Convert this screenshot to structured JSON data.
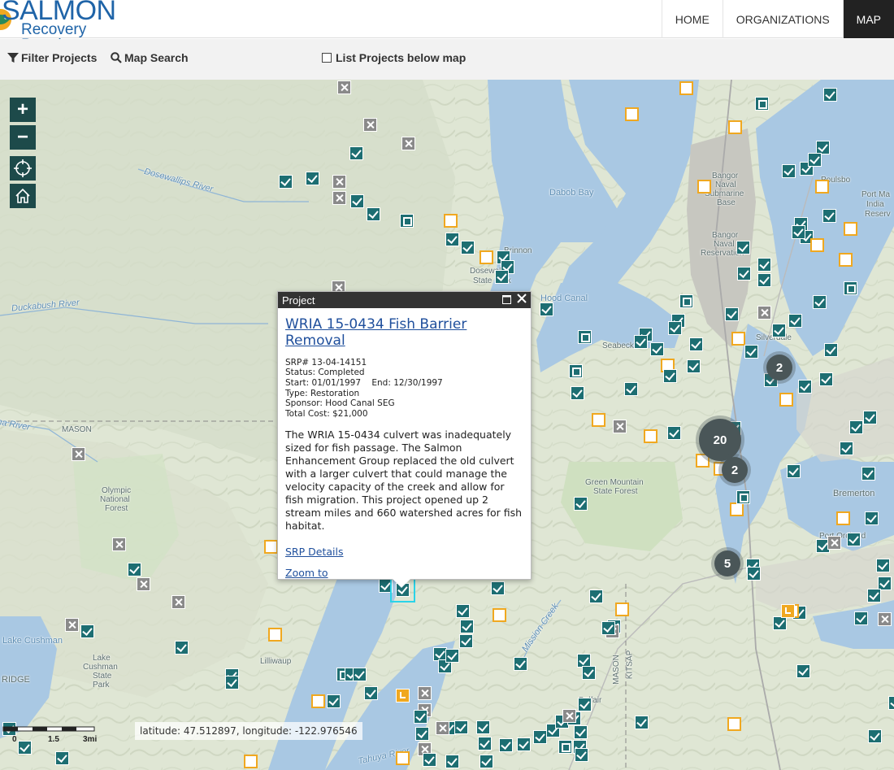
{
  "header": {
    "logo_line1": "SALMON",
    "logo_line2": "Recovery Portal",
    "nav": [
      "HOME",
      "ORGANIZATIONS",
      "MAP"
    ],
    "active_nav": "MAP"
  },
  "toolbar": {
    "filter_label": "Filter Projects",
    "search_label": "Map Search",
    "list_label": "List Projects below map"
  },
  "map": {
    "places": {
      "dabob_bay": "Dabob Bay",
      "brinnon": "Brinnon",
      "dosewallips_state_park_1": "Dosewallips",
      "dosewallips_state_park_2": "State Park",
      "hood_canal": "Hood Canal",
      "seabeck": "Seabeck",
      "silverdale": "Silverdale",
      "bangor_base_1": "Bangor",
      "bangor_base_2": "Naval",
      "bangor_base_3": "Submarine",
      "bangor_base_4": "Base",
      "bangor_res_1": "Bangor",
      "bangor_res_2": "Naval",
      "bangor_res_3": "Reservation",
      "poulsbo": "Poulsbo",
      "port_madison_1": "Port Ma",
      "port_madison_2": "India",
      "port_madison_3": "Reserv",
      "dosewallips_river": "Dosewallips River",
      "duckabush_river": "Duckabush River",
      "hamma_river": "Hamma River",
      "mason": "MASON",
      "olympic_nf_1": "Olympic",
      "olympic_nf_2": "National",
      "olympic_nf_3": "Forest",
      "green_mountain_1": "Green Mountain",
      "green_mountain_2": "State Forest",
      "bremerton": "Bremerton",
      "port_orchard": "Port Orchard",
      "lake_cushman": "Lake Cushman",
      "lake_cushman_park_1": "Lake",
      "lake_cushman_park_2": "Cushman",
      "lake_cushman_park_3": "State",
      "lake_cushman_park_4": "Park",
      "lilliwaup": "Lilliwaup",
      "mission_creek": "Mission Creek",
      "mason_county": "MASON",
      "kitsap_county": "KITSAP",
      "ridge": "RIDGE",
      "belfair": "Belfair",
      "tahuya": "Tahuya River"
    },
    "clusters": {
      "c20": "20",
      "c2a": "2",
      "c2b": "2",
      "c5": "5"
    },
    "scale": {
      "s0": "0",
      "s1": "1.5",
      "s2": "3mi"
    },
    "coords": "latitude: 47.512897, longitude: -122.976546"
  },
  "popup": {
    "header": "Project",
    "title": "WRIA 15-0434 Fish Barrier Removal",
    "srp": "SRP# 13-04-14151",
    "status": "Status: Completed",
    "dates": "Start: 01/01/1997    End: 12/30/1997",
    "type": "Type: Restoration",
    "sponsor": "Sponsor: Hood Canal SEG",
    "cost": "Total Cost: $21,000",
    "description": "The WRIA 15-0434 culvert was inadequately sized for fish passage. The Salmon Enhancement Group replaced the old culvert with a larger culvert that could manage the velocity capacity of the creek and allow for fish migration. This project opened up 2 stream miles and 660 watershed acres for fish habitat.",
    "link_details": "SRP Details",
    "link_zoom": "Zoom to"
  },
  "colors": {
    "marker_complete": "#1d6e72",
    "marker_active": "#f0a820",
    "marker_cancelled": "#8a8a8a",
    "cluster": "#4a5658",
    "water": "#a9c8e3",
    "land": "#e3e9d8"
  }
}
